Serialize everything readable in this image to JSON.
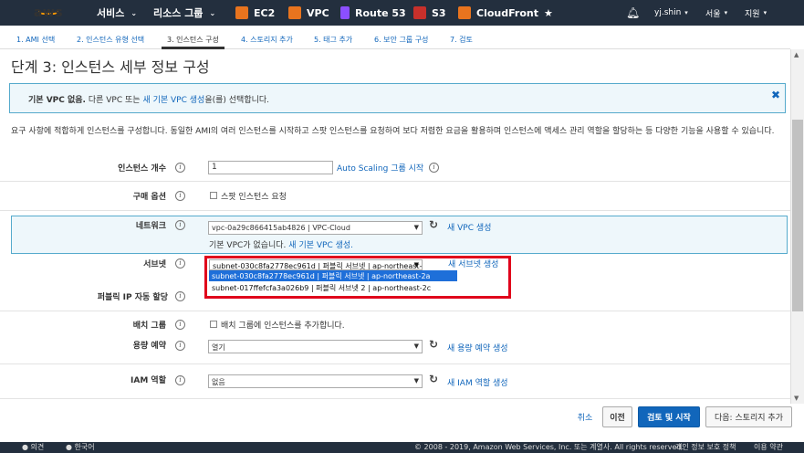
{
  "nav": {
    "logo": "aws",
    "services": "서비스",
    "resource_groups": "리소스 그룹",
    "shortcuts": [
      {
        "label": "EC2",
        "color": "#e8741e"
      },
      {
        "label": "VPC",
        "color": "#e8741e"
      },
      {
        "label": "Route 53",
        "color": "#8c4fff"
      },
      {
        "label": "S3",
        "color": "#c7302b"
      },
      {
        "label": "CloudFront",
        "color": "#e8741e"
      }
    ],
    "user": "yj.shin",
    "region": "서울",
    "support": "지원"
  },
  "tabs": [
    {
      "label": "1. AMI 선택"
    },
    {
      "label": "2. 인스턴스 유형 선택"
    },
    {
      "label": "3. 인스턴스 구성"
    },
    {
      "label": "4. 스토리지 추가"
    },
    {
      "label": "5. 태그 추가"
    },
    {
      "label": "6. 보안 그룹 구성"
    },
    {
      "label": "7. 검토"
    }
  ],
  "page_title": "단계 3: 인스턴스 세부 정보 구성",
  "info_box": {
    "bold": "기본 VPC 없음.",
    "pre": "다른 VPC 또는",
    "link": "새 기본 VPC 생성",
    "post": "을(를) 선택합니다."
  },
  "description": "요구 사항에 적합하게 인스턴스를 구성합니다. 동일한 AMI의 여러 인스턴스를 시작하고 스팟 인스턴스를 요청하여 보다 저렴한 요금을 활용하며 인스턴스에 액세스 관리 역할을 할당하는 등 다양한 기능을 사용할 수 있습니다.",
  "form": {
    "instance_count": {
      "label": "인스턴스 개수",
      "value": "1",
      "link": "Auto Scaling 그룹 시작"
    },
    "purchase": {
      "label": "구매 옵션",
      "checkbox": "스팟 인스턴스 요청"
    },
    "network": {
      "label": "네트워크",
      "value": "vpc-0a29c866415ab4826 | VPC-Cloud",
      "link": "새 VPC 생성",
      "note": "기본 VPC가 없습니다.",
      "note_link": "새 기본 VPC 생성."
    },
    "subnet": {
      "label": "서브넷",
      "link": "새 서브넷 생성",
      "options": [
        "subnet-030c8fa2778ec961d | 퍼블릭 서브넷 | ap-northeast-2a",
        "subnet-030c8fa2778ec961d | 퍼블릭 서브넷 | ap-northeast-2a",
        "subnet-017ffefcfa3a026b9 | 퍼블릭 서브넷 2 | ap-northeast-2c"
      ]
    },
    "public_ip": {
      "label": "퍼블릭 IP 자동 할당"
    },
    "placement": {
      "label": "배치 그룹",
      "checkbox": "배치 그룹에 인스턴스를 추가합니다."
    },
    "capacity": {
      "label": "용량 예약",
      "value": "열기",
      "link": "새 용량 예약 생성"
    },
    "iam": {
      "label": "IAM 역할",
      "value": "없음",
      "link": "새 IAM 역할 생성"
    }
  },
  "buttons": {
    "cancel": "취소",
    "prev": "이전",
    "review": "검토 및 시작",
    "next": "다음: 스토리지 추가"
  },
  "footer": {
    "feedback": "의견",
    "language": "한국어",
    "copyright": "© 2008 - 2019, Amazon Web Services, Inc. 또는 계열사. All rights reserved.",
    "privacy": "개인 정보 보호 정책",
    "terms": "이용 약관"
  }
}
